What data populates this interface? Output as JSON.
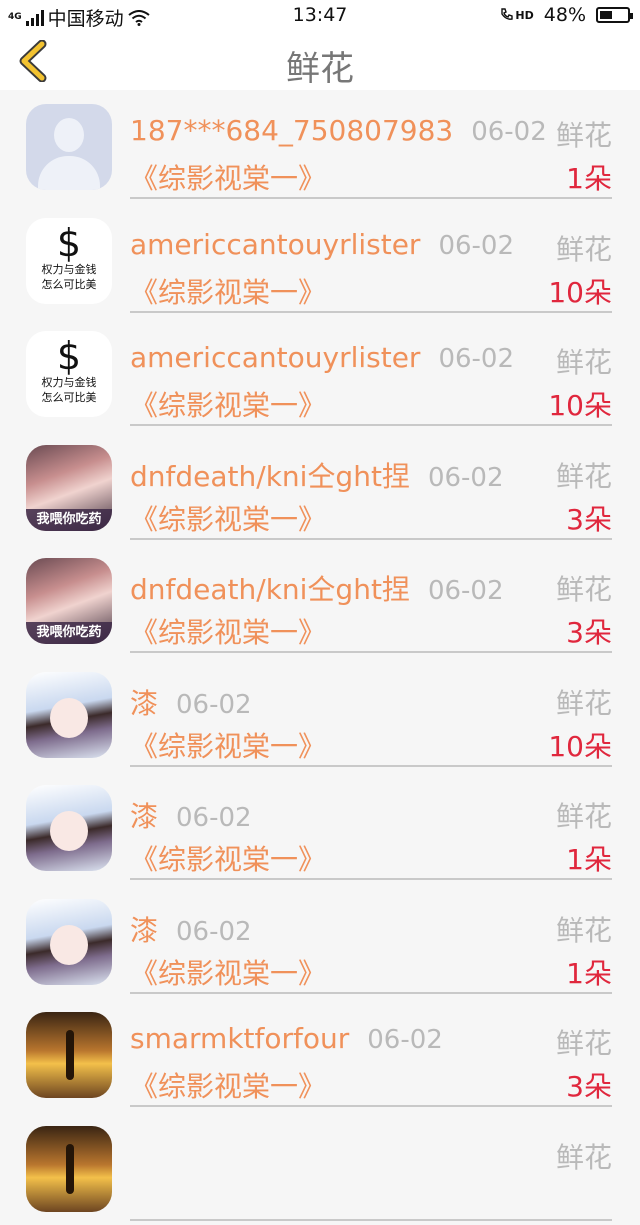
{
  "status_bar": {
    "network": "4G",
    "carrier": "中国移动",
    "time": "13:47",
    "hd": "HD",
    "battery_percent": "48%",
    "battery_level": 0.48
  },
  "nav": {
    "back_icon": "chevron-left-icon",
    "title": "鲜花"
  },
  "rows": [
    {
      "name": "187***684_750807983",
      "date": "06-02",
      "kind": "鲜花",
      "post": "《综影视棠一》",
      "count": "1朵",
      "avatar": "silhouette"
    },
    {
      "name": "americcantouyrlister",
      "date": "06-02",
      "kind": "鲜花",
      "post": "《综影视棠一》",
      "count": "10朵",
      "avatar": "money",
      "avatar_text1": "权力与金钱",
      "avatar_text2": "怎么可比美"
    },
    {
      "name": "americcantouyrlister",
      "date": "06-02",
      "kind": "鲜花",
      "post": "《综影视棠一》",
      "count": "10朵",
      "avatar": "money",
      "avatar_text1": "权力与金钱",
      "avatar_text2": "怎么可比美"
    },
    {
      "name": "dnfdeath/kni仝ght捏",
      "date": "06-02",
      "kind": "鲜花",
      "post": "《综影视棠一》",
      "count": "3朵",
      "avatar": "girl",
      "avatar_caption": "我喂你吃药"
    },
    {
      "name": "dnfdeath/kni仝ght捏",
      "date": "06-02",
      "kind": "鲜花",
      "post": "《综影视棠一》",
      "count": "3朵",
      "avatar": "girl",
      "avatar_caption": "我喂你吃药"
    },
    {
      "name": "漆",
      "date": "06-02",
      "kind": "鲜花",
      "post": "《综影视棠一》",
      "count": "10朵",
      "avatar": "anime"
    },
    {
      "name": "漆",
      "date": "06-02",
      "kind": "鲜花",
      "post": "《综影视棠一》",
      "count": "1朵",
      "avatar": "anime"
    },
    {
      "name": "漆",
      "date": "06-02",
      "kind": "鲜花",
      "post": "《综影视棠一》",
      "count": "1朵",
      "avatar": "anime"
    },
    {
      "name": "smarmktforfour",
      "date": "06-02",
      "kind": "鲜花",
      "post": "《综影视棠一》",
      "count": "3朵",
      "avatar": "sunset"
    },
    {
      "name": "",
      "date": "",
      "kind": "鲜花",
      "post": "",
      "count": "",
      "avatar": "sunset"
    }
  ],
  "colors": {
    "accent_orange": "#f0915a",
    "count_red": "#e0273d",
    "muted_gray": "#b9b9b9",
    "back_arrow_yellow": "#f2c230"
  }
}
